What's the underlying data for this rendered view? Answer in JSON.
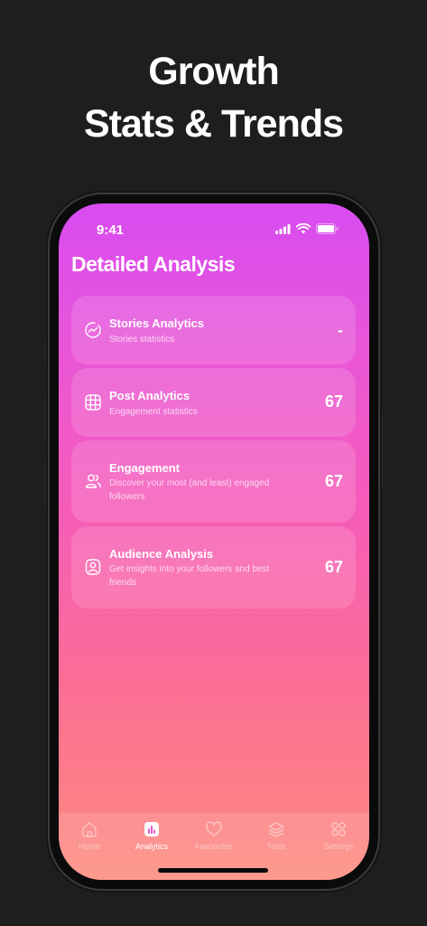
{
  "headline": {
    "line1": "Growth",
    "line2": "Stats & Trends"
  },
  "status_bar": {
    "time": "9:41"
  },
  "screen": {
    "title": "Detailed Analysis"
  },
  "cards": [
    {
      "icon": "trend-chart-icon",
      "title": "Stories Analytics",
      "subtitle": "Stories statistics",
      "value": "-"
    },
    {
      "icon": "grid-icon",
      "title": "Post Analytics",
      "subtitle": "Engagement statistics",
      "value": "67"
    },
    {
      "icon": "users-icon",
      "title": "Engagement",
      "subtitle": "Discover your most (and least) engaged followers",
      "value": "67"
    },
    {
      "icon": "profile-badge-icon",
      "title": "Audience Analysis",
      "subtitle": "Get insights into your followers and best friends",
      "value": "67"
    }
  ],
  "tabbar": {
    "items": [
      {
        "label": "Home",
        "icon": "home-icon",
        "active": false
      },
      {
        "label": "Analytics",
        "icon": "bar-chart-icon",
        "active": true
      },
      {
        "label": "Favourites",
        "icon": "heart-icon",
        "active": false
      },
      {
        "label": "Tools",
        "icon": "layers-icon",
        "active": false
      },
      {
        "label": "Settings",
        "icon": "apps-grid-icon",
        "active": false
      }
    ]
  },
  "colors": {
    "background": "#1e1e1e",
    "gradient_top": "#d84cf1",
    "gradient_bottom": "#fd8c7d"
  }
}
